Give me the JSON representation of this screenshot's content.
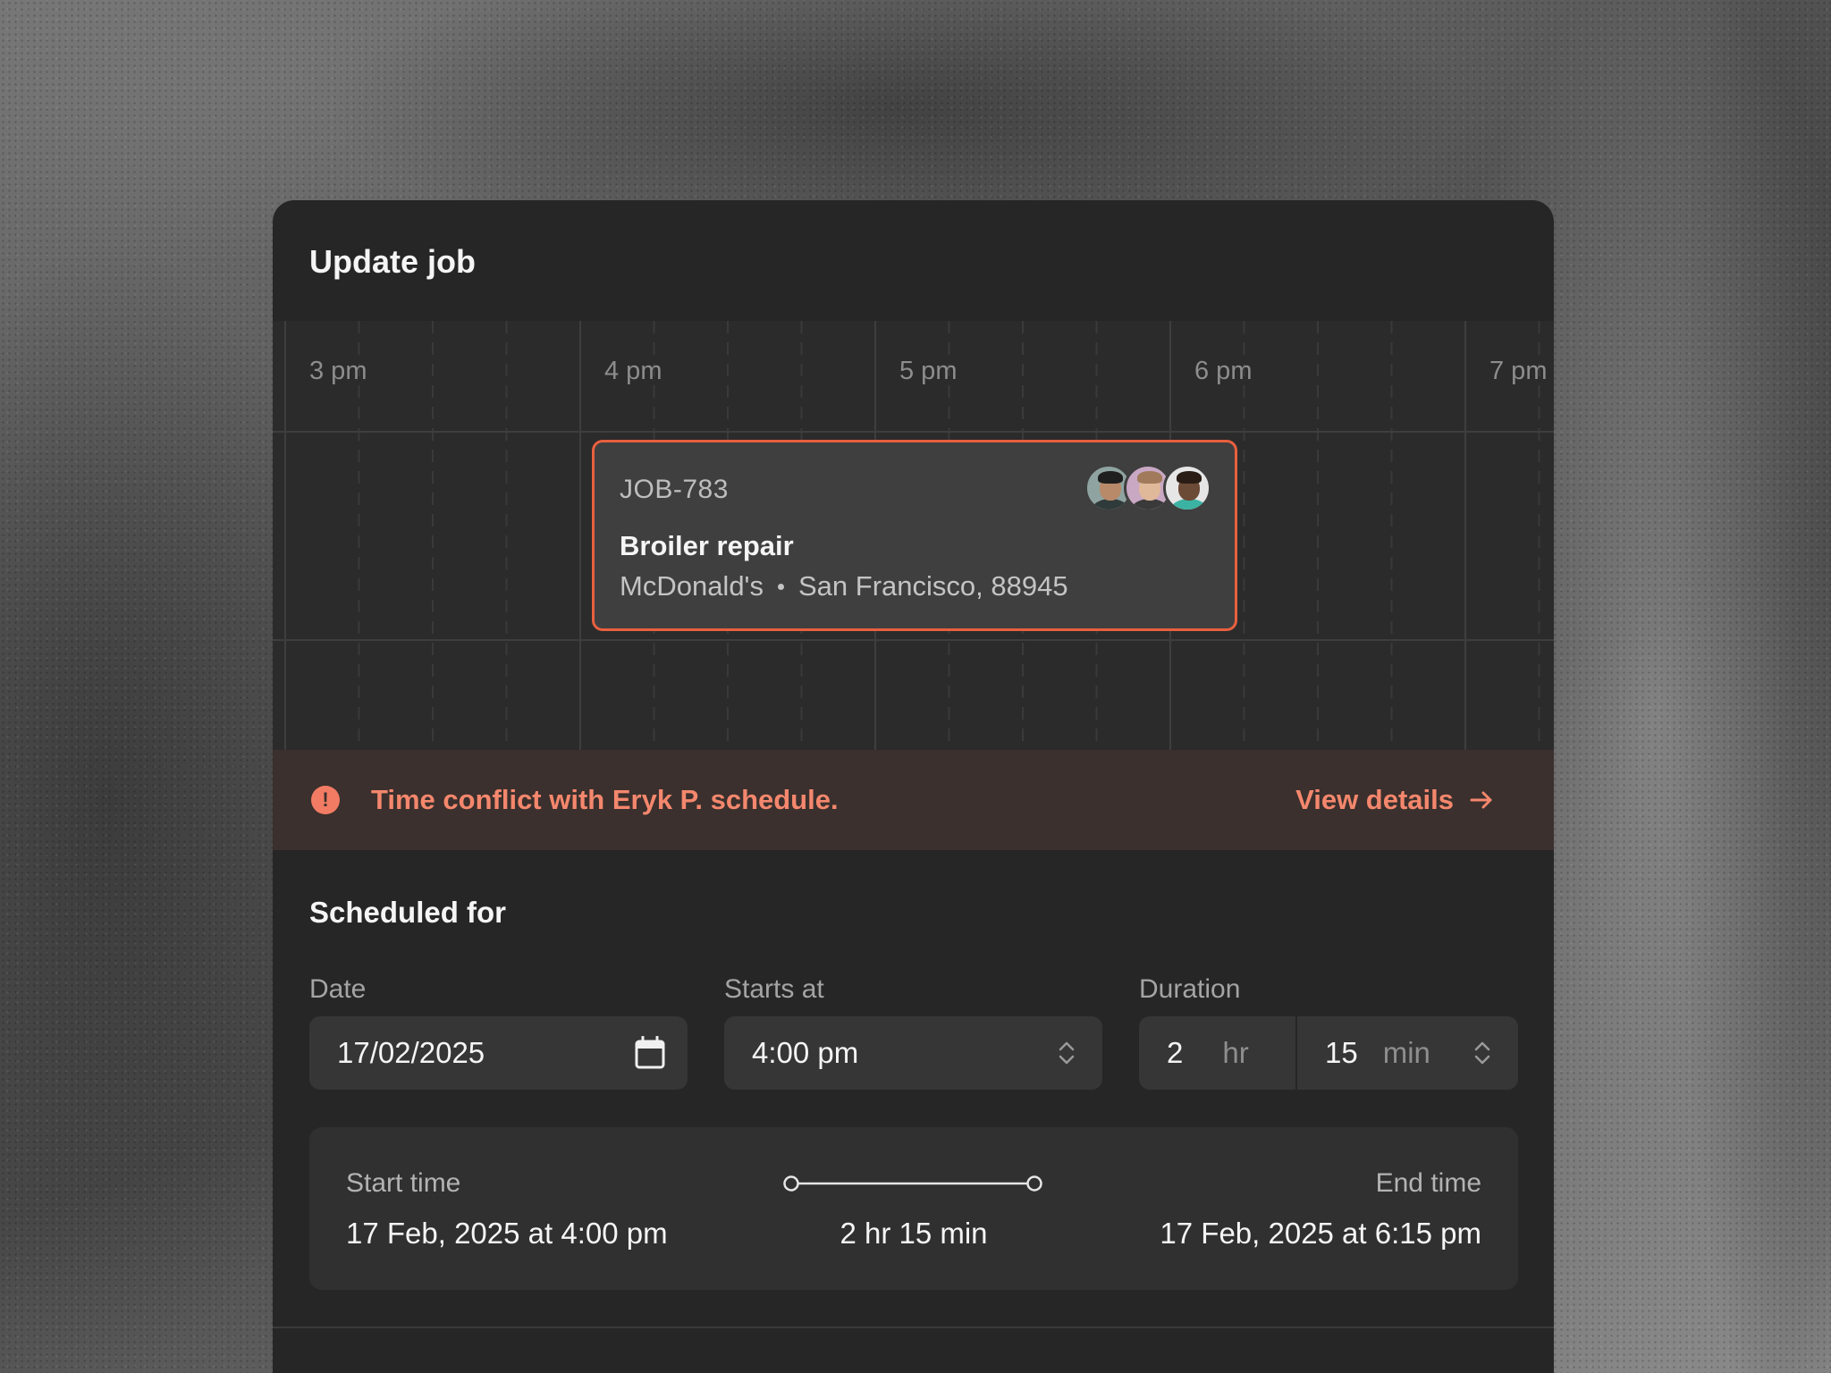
{
  "dialog": {
    "title": "Update job"
  },
  "timeline": {
    "hours": [
      "3 pm",
      "4 pm",
      "5 pm",
      "6 pm",
      "7 pm"
    ]
  },
  "job": {
    "id": "JOB-783",
    "title": "Broiler repair",
    "customer": "McDonald's",
    "location": "San Francisco, 88945",
    "assignees": [
      "avatar-1",
      "avatar-2",
      "avatar-3"
    ]
  },
  "conflict": {
    "message": "Time conflict with Eryk P. schedule.",
    "action_label": "View details",
    "icon": "alert-circle-icon",
    "color": "#f4876d"
  },
  "schedule": {
    "section_title": "Scheduled for",
    "date": {
      "label": "Date",
      "value": "17/02/2025",
      "icon": "calendar-icon"
    },
    "starts_at": {
      "label": "Starts at",
      "value": "4:00 pm",
      "icon": "chevron-up-down-icon"
    },
    "duration": {
      "label": "Duration",
      "hours": "2",
      "hours_unit": "hr",
      "minutes": "15",
      "minutes_unit": "min",
      "icon": "chevron-up-down-icon"
    }
  },
  "summary": {
    "start_label": "Start time",
    "start_value": "17 Feb, 2025 at 4:00 pm",
    "duration_value": "2 hr 15 min",
    "end_label": "End time",
    "end_value": "17 Feb, 2025 at 6:15 pm"
  },
  "colors": {
    "accent": "#e8603f",
    "panel": "#262626"
  }
}
